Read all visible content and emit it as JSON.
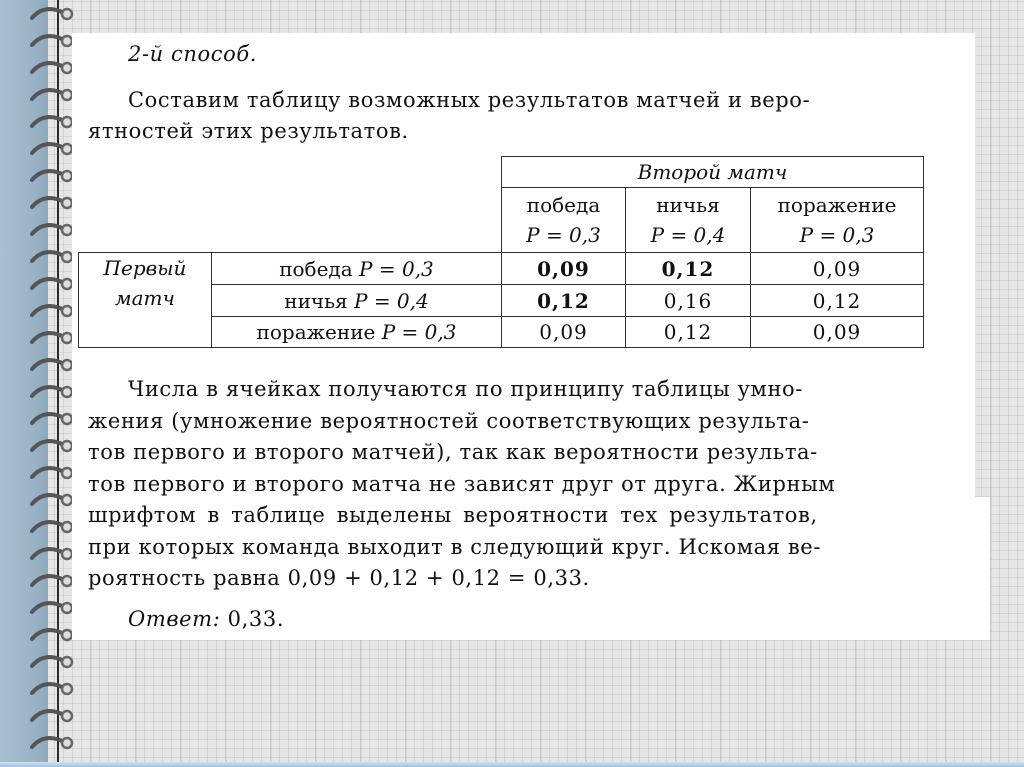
{
  "heading": "2-й способ.",
  "intro": {
    "line1": "Составим таблицу возможных результатов матчей и веро-",
    "line2": "ятностей этих результатов."
  },
  "table": {
    "col_group_header": "Второй матч",
    "row_group_header_line1": "Первый",
    "row_group_header_line2": "матч",
    "columns": [
      {
        "label": "победа",
        "prob": "P = 0,3"
      },
      {
        "label": "ничья",
        "prob": "P = 0,4"
      },
      {
        "label": "поражение",
        "prob": "P = 0,3"
      }
    ],
    "rows": [
      {
        "label": "победа",
        "prob": "P = 0,3",
        "cells": [
          {
            "value": "0,09",
            "bold": true
          },
          {
            "value": "0,12",
            "bold": true
          },
          {
            "value": "0,09",
            "bold": false
          }
        ]
      },
      {
        "label": "ничья",
        "prob": "P = 0,4",
        "cells": [
          {
            "value": "0,12",
            "bold": true
          },
          {
            "value": "0,16",
            "bold": false
          },
          {
            "value": "0,12",
            "bold": false
          }
        ]
      },
      {
        "label": "поражение",
        "prob": "P = 0,3",
        "cells": [
          {
            "value": "0,09",
            "bold": false
          },
          {
            "value": "0,12",
            "bold": false
          },
          {
            "value": "0,09",
            "bold": false
          }
        ]
      }
    ]
  },
  "explanation": {
    "lines": [
      "Числа в ячейках получаются по принципу таблицы умно-",
      "жения (умножение вероятностей соответствующих результа-",
      "тов первого и второго матчей), так как вероятности результа-",
      "тов первого и второго матча не зависят друг от друга. Жирным",
      "шрифтом в таблице выделены вероятности тех результатов,",
      "при которых команда выходит в следующий круг. Искомая ве-",
      "роятность равна 0,09 + 0,12 + 0,12 = 0,33."
    ]
  },
  "answer": {
    "label": "Ответ:",
    "value": "0,33."
  }
}
